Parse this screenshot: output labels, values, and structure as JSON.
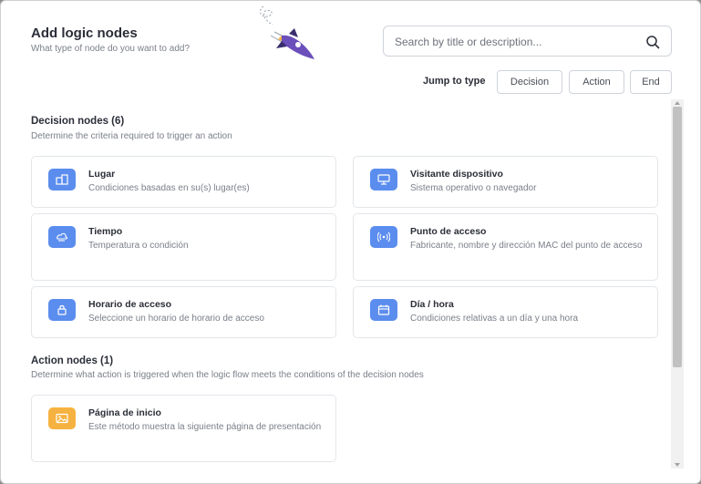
{
  "header": {
    "title": "Add logic nodes",
    "subtitle": "What type of node do you want to add?"
  },
  "search": {
    "placeholder": "Search by title or description..."
  },
  "jump": {
    "label": "Jump to type",
    "buttons": [
      "Decision",
      "Action",
      "End"
    ]
  },
  "decision": {
    "title": "Decision nodes (6)",
    "desc": "Determine the criteria required to trigger an action",
    "cards": [
      {
        "title": "Lugar",
        "desc": "Condiciones basadas en su(s) lugar(es)",
        "icon": "building-icon"
      },
      {
        "title": "Visitante dispositivo",
        "desc": "Sistema operativo o navegador",
        "icon": "monitor-icon"
      },
      {
        "title": "Tiempo",
        "desc": "Temperatura o condición",
        "icon": "weather-icon"
      },
      {
        "title": "Punto de acceso",
        "desc": "Fabricante, nombre y dirección MAC del punto de acceso",
        "icon": "wifi-antenna-icon"
      },
      {
        "title": "Horario de acceso",
        "desc": "Seleccione un horario de horario de acceso",
        "icon": "lock-icon"
      },
      {
        "title": "Día / hora",
        "desc": "Condiciones relativas a un día y una hora",
        "icon": "calendar-icon"
      }
    ]
  },
  "action": {
    "title": "Action nodes (1)",
    "desc": "Determine what action is triggered when the logic flow meets the conditions of the decision nodes",
    "cards": [
      {
        "title": "Página de inicio",
        "desc": "Este método muestra la siguiente página de presentación",
        "icon": "image-icon"
      }
    ]
  },
  "colors": {
    "decision_icon_bg": "#5b8def",
    "action_icon_bg": "#f6b240",
    "rocket_purple": "#6b4fbb"
  }
}
